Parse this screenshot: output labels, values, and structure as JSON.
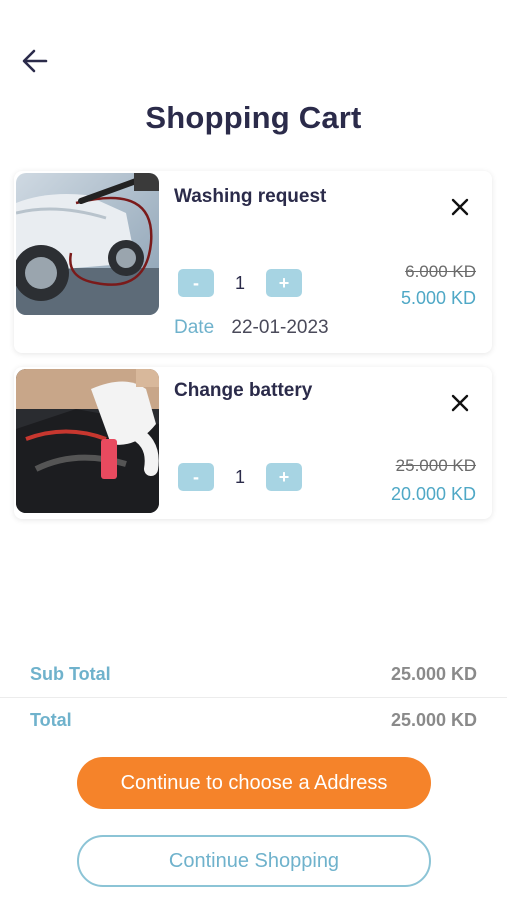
{
  "header": {
    "title": "Shopping Cart"
  },
  "cart": {
    "items": [
      {
        "name": "Washing request",
        "quantity": "1",
        "old_price": "6.000 KD",
        "price": "5.000 KD",
        "date_label": "Date",
        "date": "22-01-2023",
        "minus": "-",
        "plus": "+"
      },
      {
        "name": "Change battery",
        "quantity": "1",
        "old_price": "25.000 KD",
        "price": "20.000 KD",
        "minus": "-",
        "plus": "+"
      }
    ]
  },
  "totals": {
    "subtotal_label": "Sub Total",
    "subtotal_value": "25.000 KD",
    "total_label": "Total",
    "total_value": "25.000 KD"
  },
  "actions": {
    "primary": "Continue to choose a Address",
    "secondary": "Continue Shopping"
  },
  "colors": {
    "accent_orange": "#f5832a",
    "accent_blue": "#4fa8c6",
    "title_dark": "#2b2b4a"
  }
}
